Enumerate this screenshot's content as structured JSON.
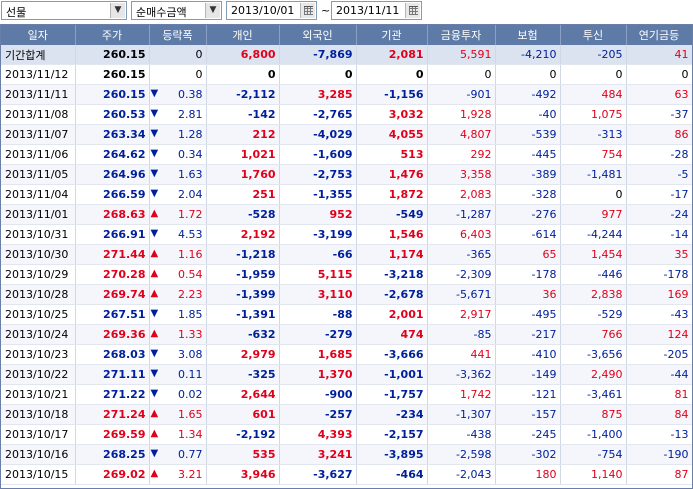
{
  "toolbar": {
    "market": "선물",
    "mode": "순매수금액",
    "from_date": "2013/10/01",
    "to_date": "2013/11/11",
    "separator": "~"
  },
  "headers": [
    "일자",
    "주가",
    "등락폭",
    "개인",
    "외국인",
    "기관",
    "금융투자",
    "보험",
    "투신",
    "연기금등"
  ],
  "summary": {
    "date": "기간합계",
    "price": "260.15",
    "change": "0",
    "gaein": "6,800",
    "foreign": "-7,869",
    "inst": "2,081",
    "fin": "5,591",
    "ins": "-4,210",
    "trust": "-205",
    "pension": "41"
  },
  "rows": [
    {
      "date": "2013/11/12",
      "price": "260.15",
      "dir": "flat",
      "change": "0",
      "gaein": "0",
      "foreign": "0",
      "inst": "0",
      "fin": "0",
      "ins": "0",
      "trust": "0",
      "pension": "0"
    },
    {
      "date": "2013/11/11",
      "price": "260.15",
      "dir": "down",
      "change": "0.38",
      "gaein": "-2,112",
      "foreign": "3,285",
      "inst": "-1,156",
      "fin": "-901",
      "ins": "-492",
      "trust": "484",
      "pension": "63"
    },
    {
      "date": "2013/11/08",
      "price": "260.53",
      "dir": "down",
      "change": "2.81",
      "gaein": "-142",
      "foreign": "-2,765",
      "inst": "3,032",
      "fin": "1,928",
      "ins": "-40",
      "trust": "1,075",
      "pension": "-37"
    },
    {
      "date": "2013/11/07",
      "price": "263.34",
      "dir": "down",
      "change": "1.28",
      "gaein": "212",
      "foreign": "-4,029",
      "inst": "4,055",
      "fin": "4,807",
      "ins": "-539",
      "trust": "-313",
      "pension": "86"
    },
    {
      "date": "2013/11/06",
      "price": "264.62",
      "dir": "down",
      "change": "0.34",
      "gaein": "1,021",
      "foreign": "-1,609",
      "inst": "513",
      "fin": "292",
      "ins": "-445",
      "trust": "754",
      "pension": "-28"
    },
    {
      "date": "2013/11/05",
      "price": "264.96",
      "dir": "down",
      "change": "1.63",
      "gaein": "1,760",
      "foreign": "-2,753",
      "inst": "1,476",
      "fin": "3,358",
      "ins": "-389",
      "trust": "-1,481",
      "pension": "-5"
    },
    {
      "date": "2013/11/04",
      "price": "266.59",
      "dir": "down",
      "change": "2.04",
      "gaein": "251",
      "foreign": "-1,355",
      "inst": "1,872",
      "fin": "2,083",
      "ins": "-328",
      "trust": "0",
      "pension": "-17"
    },
    {
      "date": "2013/11/01",
      "price": "268.63",
      "dir": "up",
      "change": "1.72",
      "gaein": "-528",
      "foreign": "952",
      "inst": "-549",
      "fin": "-1,287",
      "ins": "-276",
      "trust": "977",
      "pension": "-24"
    },
    {
      "date": "2013/10/31",
      "price": "266.91",
      "dir": "down",
      "change": "4.53",
      "gaein": "2,192",
      "foreign": "-3,199",
      "inst": "1,546",
      "fin": "6,403",
      "ins": "-614",
      "trust": "-4,244",
      "pension": "-14"
    },
    {
      "date": "2013/10/30",
      "price": "271.44",
      "dir": "up",
      "change": "1.16",
      "gaein": "-1,218",
      "foreign": "-66",
      "inst": "1,174",
      "fin": "-365",
      "ins": "65",
      "trust": "1,454",
      "pension": "35"
    },
    {
      "date": "2013/10/29",
      "price": "270.28",
      "dir": "up",
      "change": "0.54",
      "gaein": "-1,959",
      "foreign": "5,115",
      "inst": "-3,218",
      "fin": "-2,309",
      "ins": "-178",
      "trust": "-446",
      "pension": "-178"
    },
    {
      "date": "2013/10/28",
      "price": "269.74",
      "dir": "up",
      "change": "2.23",
      "gaein": "-1,399",
      "foreign": "3,110",
      "inst": "-2,678",
      "fin": "-5,671",
      "ins": "36",
      "trust": "2,838",
      "pension": "169"
    },
    {
      "date": "2013/10/25",
      "price": "267.51",
      "dir": "down",
      "change": "1.85",
      "gaein": "-1,391",
      "foreign": "-88",
      "inst": "2,001",
      "fin": "2,917",
      "ins": "-495",
      "trust": "-529",
      "pension": "-43"
    },
    {
      "date": "2013/10/24",
      "price": "269.36",
      "dir": "up",
      "change": "1.33",
      "gaein": "-632",
      "foreign": "-279",
      "inst": "474",
      "fin": "-85",
      "ins": "-217",
      "trust": "766",
      "pension": "124"
    },
    {
      "date": "2013/10/23",
      "price": "268.03",
      "dir": "down",
      "change": "3.08",
      "gaein": "2,979",
      "foreign": "1,685",
      "inst": "-3,666",
      "fin": "441",
      "ins": "-410",
      "trust": "-3,656",
      "pension": "-205"
    },
    {
      "date": "2013/10/22",
      "price": "271.11",
      "dir": "down",
      "change": "0.11",
      "gaein": "-325",
      "foreign": "1,370",
      "inst": "-1,001",
      "fin": "-3,362",
      "ins": "-149",
      "trust": "2,490",
      "pension": "-44"
    },
    {
      "date": "2013/10/21",
      "price": "271.22",
      "dir": "down",
      "change": "0.02",
      "gaein": "2,644",
      "foreign": "-900",
      "inst": "-1,757",
      "fin": "1,742",
      "ins": "-121",
      "trust": "-3,461",
      "pension": "81"
    },
    {
      "date": "2013/10/18",
      "price": "271.24",
      "dir": "up",
      "change": "1.65",
      "gaein": "601",
      "foreign": "-257",
      "inst": "-234",
      "fin": "-1,307",
      "ins": "-157",
      "trust": "875",
      "pension": "84"
    },
    {
      "date": "2013/10/17",
      "price": "269.59",
      "dir": "up",
      "change": "1.34",
      "gaein": "-2,192",
      "foreign": "4,393",
      "inst": "-2,157",
      "fin": "-438",
      "ins": "-245",
      "trust": "-1,400",
      "pension": "-13"
    },
    {
      "date": "2013/10/16",
      "price": "268.25",
      "dir": "down",
      "change": "0.77",
      "gaein": "535",
      "foreign": "3,241",
      "inst": "-3,895",
      "fin": "-2,598",
      "ins": "-302",
      "trust": "-754",
      "pension": "-190"
    },
    {
      "date": "2013/10/15",
      "price": "269.02",
      "dir": "up",
      "change": "3.21",
      "gaein": "3,946",
      "foreign": "-3,627",
      "inst": "-464",
      "fin": "-2,043",
      "ins": "180",
      "trust": "1,140",
      "pension": "87"
    }
  ],
  "colors": {
    "up": "#e0001a",
    "down": "#00209b",
    "header": "#5e7ba8"
  },
  "icons": {
    "up": "▲",
    "down": "▼",
    "dropdown": "chevron-down-icon",
    "calendar": "calendar-icon"
  }
}
